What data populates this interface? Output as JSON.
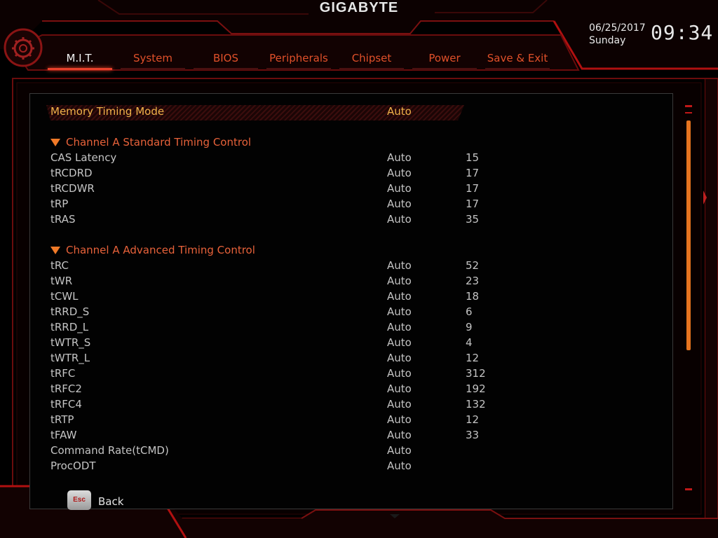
{
  "brand": "GIGABYTE",
  "datetime": {
    "date": "06/25/2017",
    "day": "Sunday",
    "time": "09:34"
  },
  "tabs": [
    {
      "label": "M.I.T.",
      "active": true
    },
    {
      "label": "System"
    },
    {
      "label": "BIOS"
    },
    {
      "label": "Peripherals"
    },
    {
      "label": "Chipset"
    },
    {
      "label": "Power"
    },
    {
      "label": "Save & Exit"
    }
  ],
  "settings": {
    "memory_timing_mode": {
      "label": "Memory Timing Mode",
      "option": "Auto"
    },
    "standard_section": "Channel A Standard Timing Control",
    "standard": [
      {
        "label": "CAS Latency",
        "option": "Auto",
        "value": "15"
      },
      {
        "label": "tRCDRD",
        "option": "Auto",
        "value": "17"
      },
      {
        "label": "tRCDWR",
        "option": "Auto",
        "value": "17"
      },
      {
        "label": "tRP",
        "option": "Auto",
        "value": "17"
      },
      {
        "label": "tRAS",
        "option": "Auto",
        "value": "35"
      }
    ],
    "advanced_section": "Channel A Advanced Timing Control",
    "advanced": [
      {
        "label": "tRC",
        "option": "Auto",
        "value": "52"
      },
      {
        "label": "tWR",
        "option": "Auto",
        "value": "23"
      },
      {
        "label": "tCWL",
        "option": "Auto",
        "value": "18"
      },
      {
        "label": "tRRD_S",
        "option": "Auto",
        "value": "6"
      },
      {
        "label": "tRRD_L",
        "option": "Auto",
        "value": "9"
      },
      {
        "label": "tWTR_S",
        "option": "Auto",
        "value": "4"
      },
      {
        "label": "tWTR_L",
        "option": "Auto",
        "value": "12"
      },
      {
        "label": "tRFC",
        "option": "Auto",
        "value": "312"
      },
      {
        "label": "tRFC2",
        "option": "Auto",
        "value": "192"
      },
      {
        "label": "tRFC4",
        "option": "Auto",
        "value": "132"
      },
      {
        "label": "tRTP",
        "option": "Auto",
        "value": "12"
      },
      {
        "label": "tFAW",
        "option": "Auto",
        "value": "33"
      },
      {
        "label": "Command Rate(tCMD)",
        "option": "Auto",
        "value": ""
      },
      {
        "label": "ProcODT",
        "option": "Auto",
        "value": ""
      }
    ]
  },
  "footer": {
    "esc_key": "Esc",
    "back_label": "Back"
  },
  "colors": {
    "accent": "#e8412c",
    "tab_text": "#e0502a",
    "selected_text": "#f0b24a",
    "scroll": "#e6731f"
  },
  "icons": {
    "menu": "gear-icon",
    "section": "triangle-down-icon"
  }
}
